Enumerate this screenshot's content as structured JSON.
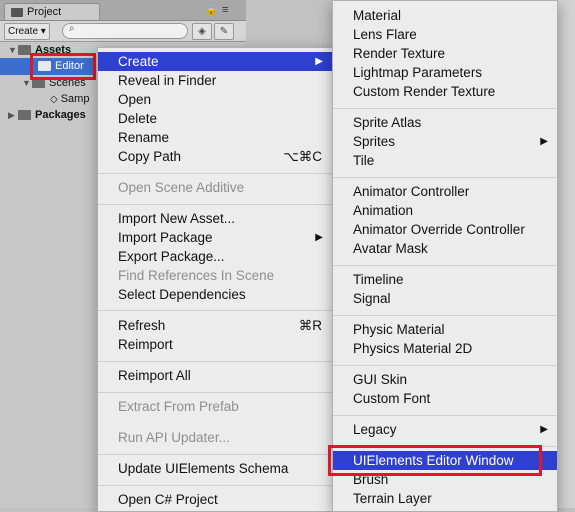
{
  "project_panel": {
    "tab_title": "Project",
    "lock_icon": "lock-icon",
    "menu_icon": "panel-menu-icon",
    "create_label": "Create",
    "create_arrow": "▾",
    "search_placeholder": "",
    "tree": [
      {
        "label": "Assets",
        "arrow": "▼"
      },
      {
        "label": "Editor",
        "selected": true
      },
      {
        "label": "Scenes",
        "arrow": "▼"
      },
      {
        "label": "Samp"
      },
      {
        "label": "Packages",
        "arrow": "▶"
      }
    ]
  },
  "context_menu": {
    "items": [
      {
        "label": "Create",
        "submenu": true,
        "highlighted": true
      },
      {
        "label": "Reveal in Finder"
      },
      {
        "label": "Open"
      },
      {
        "label": "Delete"
      },
      {
        "label": "Rename"
      },
      {
        "label": "Copy Path",
        "shortcut": "⌥⌘C"
      },
      {
        "label": "Open Scene Additive",
        "disabled": true
      },
      {
        "label": "Import New Asset..."
      },
      {
        "label": "Import Package",
        "submenu": true
      },
      {
        "label": "Export Package..."
      },
      {
        "label": "Find References In Scene",
        "disabled": true
      },
      {
        "label": "Select Dependencies"
      },
      {
        "label": "Refresh",
        "shortcut": "⌘R"
      },
      {
        "label": "Reimport"
      },
      {
        "label": "Reimport All"
      },
      {
        "label": "Extract From Prefab",
        "disabled": true
      },
      {
        "label": "Run API Updater...",
        "disabled": true
      },
      {
        "label": "Update UIElements Schema"
      },
      {
        "label": "Open C# Project"
      }
    ]
  },
  "create_submenu": {
    "items": [
      {
        "label": "Material"
      },
      {
        "label": "Lens Flare"
      },
      {
        "label": "Render Texture"
      },
      {
        "label": "Lightmap Parameters"
      },
      {
        "label": "Custom Render Texture"
      },
      {
        "label": "Sprite Atlas"
      },
      {
        "label": "Sprites",
        "submenu": true
      },
      {
        "label": "Tile"
      },
      {
        "label": "Animator Controller"
      },
      {
        "label": "Animation"
      },
      {
        "label": "Animator Override Controller"
      },
      {
        "label": "Avatar Mask"
      },
      {
        "label": "Timeline"
      },
      {
        "label": "Signal"
      },
      {
        "label": "Physic Material"
      },
      {
        "label": "Physics Material 2D"
      },
      {
        "label": "GUI Skin"
      },
      {
        "label": "Custom Font"
      },
      {
        "label": "Legacy",
        "submenu": true
      },
      {
        "label": "UIElements Editor Window",
        "highlighted": true
      },
      {
        "label": "Brush"
      },
      {
        "label": "Terrain Layer"
      }
    ]
  },
  "colors": {
    "highlight": "#2f3fd0",
    "annotation": "#e0162b",
    "selection": "#3d6ecf"
  }
}
